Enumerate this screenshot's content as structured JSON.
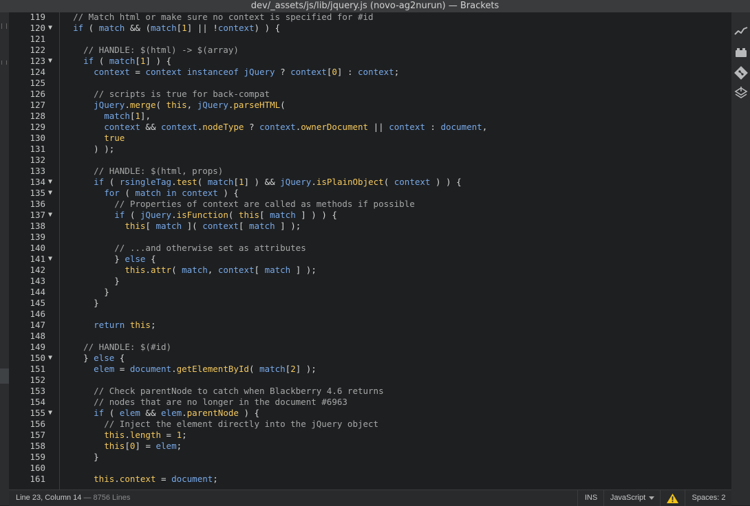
{
  "window": {
    "title": "dev/_assets/js/lib/jquery.js (novo-ag2nurun) — Brackets"
  },
  "editor": {
    "lines": [
      {
        "num": "119",
        "fold": "",
        "indent": "  ",
        "tokens": [
          {
            "t": "// Match html or make sure no context is specified for #id",
            "c": "comment"
          }
        ]
      },
      {
        "num": "120",
        "fold": "▼",
        "indent": "  ",
        "tokens": [
          {
            "t": "if",
            "c": "kw"
          },
          {
            "t": " ( ",
            "c": "plain"
          },
          {
            "t": "match",
            "c": "var"
          },
          {
            "t": " && (",
            "c": "plain"
          },
          {
            "t": "match",
            "c": "var"
          },
          {
            "t": "[",
            "c": "plain"
          },
          {
            "t": "1",
            "c": "num"
          },
          {
            "t": "] || !",
            "c": "plain"
          },
          {
            "t": "context",
            "c": "var"
          },
          {
            "t": ") ) {",
            "c": "plain"
          }
        ]
      },
      {
        "num": "121",
        "fold": "",
        "indent": "",
        "tokens": []
      },
      {
        "num": "122",
        "fold": "",
        "indent": "    ",
        "tokens": [
          {
            "t": "// HANDLE: $(html) -> $(array)",
            "c": "comment"
          }
        ]
      },
      {
        "num": "123",
        "fold": "▼",
        "indent": "    ",
        "tokens": [
          {
            "t": "if",
            "c": "kw"
          },
          {
            "t": " ( ",
            "c": "plain"
          },
          {
            "t": "match",
            "c": "var"
          },
          {
            "t": "[",
            "c": "plain"
          },
          {
            "t": "1",
            "c": "num"
          },
          {
            "t": "] ) {",
            "c": "plain"
          }
        ]
      },
      {
        "num": "124",
        "fold": "",
        "indent": "      ",
        "tokens": [
          {
            "t": "context",
            "c": "var"
          },
          {
            "t": " = ",
            "c": "plain"
          },
          {
            "t": "context",
            "c": "var"
          },
          {
            "t": " instanceof ",
            "c": "kw"
          },
          {
            "t": "jQuery",
            "c": "var"
          },
          {
            "t": " ? ",
            "c": "plain"
          },
          {
            "t": "context",
            "c": "var"
          },
          {
            "t": "[",
            "c": "plain"
          },
          {
            "t": "0",
            "c": "num"
          },
          {
            "t": "] : ",
            "c": "plain"
          },
          {
            "t": "context",
            "c": "var"
          },
          {
            "t": ";",
            "c": "plain"
          }
        ]
      },
      {
        "num": "125",
        "fold": "",
        "indent": "",
        "tokens": []
      },
      {
        "num": "126",
        "fold": "",
        "indent": "      ",
        "tokens": [
          {
            "t": "// scripts is true for back-compat",
            "c": "comment"
          }
        ]
      },
      {
        "num": "127",
        "fold": "",
        "indent": "      ",
        "tokens": [
          {
            "t": "jQuery",
            "c": "var"
          },
          {
            "t": ".",
            "c": "plain"
          },
          {
            "t": "merge",
            "c": "fn"
          },
          {
            "t": "( ",
            "c": "plain"
          },
          {
            "t": "this",
            "c": "lit"
          },
          {
            "t": ", ",
            "c": "plain"
          },
          {
            "t": "jQuery",
            "c": "var"
          },
          {
            "t": ".",
            "c": "plain"
          },
          {
            "t": "parseHTML",
            "c": "fn"
          },
          {
            "t": "(",
            "c": "plain"
          }
        ]
      },
      {
        "num": "128",
        "fold": "",
        "indent": "        ",
        "tokens": [
          {
            "t": "match",
            "c": "var"
          },
          {
            "t": "[",
            "c": "plain"
          },
          {
            "t": "1",
            "c": "num"
          },
          {
            "t": "],",
            "c": "plain"
          }
        ]
      },
      {
        "num": "129",
        "fold": "",
        "indent": "        ",
        "tokens": [
          {
            "t": "context",
            "c": "var"
          },
          {
            "t": " && ",
            "c": "plain"
          },
          {
            "t": "context",
            "c": "var"
          },
          {
            "t": ".",
            "c": "plain"
          },
          {
            "t": "nodeType",
            "c": "fn"
          },
          {
            "t": " ? ",
            "c": "plain"
          },
          {
            "t": "context",
            "c": "var"
          },
          {
            "t": ".",
            "c": "plain"
          },
          {
            "t": "ownerDocument",
            "c": "fn"
          },
          {
            "t": " || ",
            "c": "plain"
          },
          {
            "t": "context",
            "c": "var"
          },
          {
            "t": " : ",
            "c": "plain"
          },
          {
            "t": "document",
            "c": "var"
          },
          {
            "t": ",",
            "c": "plain"
          }
        ]
      },
      {
        "num": "130",
        "fold": "",
        "indent": "        ",
        "tokens": [
          {
            "t": "true",
            "c": "lit"
          }
        ]
      },
      {
        "num": "131",
        "fold": "",
        "indent": "      ",
        "tokens": [
          {
            "t": ") );",
            "c": "plain"
          }
        ]
      },
      {
        "num": "132",
        "fold": "",
        "indent": "",
        "tokens": []
      },
      {
        "num": "133",
        "fold": "",
        "indent": "      ",
        "tokens": [
          {
            "t": "// HANDLE: $(html, props)",
            "c": "comment"
          }
        ]
      },
      {
        "num": "134",
        "fold": "▼",
        "indent": "      ",
        "tokens": [
          {
            "t": "if",
            "c": "kw"
          },
          {
            "t": " ( ",
            "c": "plain"
          },
          {
            "t": "rsingleTag",
            "c": "var"
          },
          {
            "t": ".",
            "c": "plain"
          },
          {
            "t": "test",
            "c": "fn"
          },
          {
            "t": "( ",
            "c": "plain"
          },
          {
            "t": "match",
            "c": "var"
          },
          {
            "t": "[",
            "c": "plain"
          },
          {
            "t": "1",
            "c": "num"
          },
          {
            "t": "] ) && ",
            "c": "plain"
          },
          {
            "t": "jQuery",
            "c": "var"
          },
          {
            "t": ".",
            "c": "plain"
          },
          {
            "t": "isPlainObject",
            "c": "fn"
          },
          {
            "t": "( ",
            "c": "plain"
          },
          {
            "t": "context",
            "c": "var"
          },
          {
            "t": " ) ) {",
            "c": "plain"
          }
        ]
      },
      {
        "num": "135",
        "fold": "▼",
        "indent": "        ",
        "tokens": [
          {
            "t": "for",
            "c": "kw"
          },
          {
            "t": " ( ",
            "c": "plain"
          },
          {
            "t": "match",
            "c": "var"
          },
          {
            "t": " in ",
            "c": "kw"
          },
          {
            "t": "context",
            "c": "var"
          },
          {
            "t": " ) {",
            "c": "plain"
          }
        ]
      },
      {
        "num": "136",
        "fold": "",
        "indent": "          ",
        "tokens": [
          {
            "t": "// Properties of context are called as methods if possible",
            "c": "comment"
          }
        ]
      },
      {
        "num": "137",
        "fold": "▼",
        "indent": "          ",
        "tokens": [
          {
            "t": "if",
            "c": "kw"
          },
          {
            "t": " ( ",
            "c": "plain"
          },
          {
            "t": "jQuery",
            "c": "var"
          },
          {
            "t": ".",
            "c": "plain"
          },
          {
            "t": "isFunction",
            "c": "fn"
          },
          {
            "t": "( ",
            "c": "plain"
          },
          {
            "t": "this",
            "c": "lit"
          },
          {
            "t": "[ ",
            "c": "plain"
          },
          {
            "t": "match",
            "c": "var"
          },
          {
            "t": " ] ) ) {",
            "c": "plain"
          }
        ]
      },
      {
        "num": "138",
        "fold": "",
        "indent": "            ",
        "tokens": [
          {
            "t": "this",
            "c": "lit"
          },
          {
            "t": "[ ",
            "c": "plain"
          },
          {
            "t": "match",
            "c": "var"
          },
          {
            "t": " ]( ",
            "c": "plain"
          },
          {
            "t": "context",
            "c": "var"
          },
          {
            "t": "[ ",
            "c": "plain"
          },
          {
            "t": "match",
            "c": "var"
          },
          {
            "t": " ] );",
            "c": "plain"
          }
        ]
      },
      {
        "num": "139",
        "fold": "",
        "indent": "",
        "tokens": []
      },
      {
        "num": "140",
        "fold": "",
        "indent": "          ",
        "tokens": [
          {
            "t": "// ...and otherwise set as attributes",
            "c": "comment"
          }
        ]
      },
      {
        "num": "141",
        "fold": "▼",
        "indent": "          ",
        "tokens": [
          {
            "t": "} ",
            "c": "plain"
          },
          {
            "t": "else",
            "c": "kw"
          },
          {
            "t": " {",
            "c": "plain"
          }
        ]
      },
      {
        "num": "142",
        "fold": "",
        "indent": "            ",
        "tokens": [
          {
            "t": "this",
            "c": "lit"
          },
          {
            "t": ".",
            "c": "plain"
          },
          {
            "t": "attr",
            "c": "fn"
          },
          {
            "t": "( ",
            "c": "plain"
          },
          {
            "t": "match",
            "c": "var"
          },
          {
            "t": ", ",
            "c": "plain"
          },
          {
            "t": "context",
            "c": "var"
          },
          {
            "t": "[ ",
            "c": "plain"
          },
          {
            "t": "match",
            "c": "var"
          },
          {
            "t": " ] );",
            "c": "plain"
          }
        ]
      },
      {
        "num": "143",
        "fold": "",
        "indent": "          ",
        "tokens": [
          {
            "t": "}",
            "c": "plain"
          }
        ]
      },
      {
        "num": "144",
        "fold": "",
        "indent": "        ",
        "tokens": [
          {
            "t": "}",
            "c": "plain"
          }
        ]
      },
      {
        "num": "145",
        "fold": "",
        "indent": "      ",
        "tokens": [
          {
            "t": "}",
            "c": "plain"
          }
        ]
      },
      {
        "num": "146",
        "fold": "",
        "indent": "",
        "tokens": []
      },
      {
        "num": "147",
        "fold": "",
        "indent": "      ",
        "tokens": [
          {
            "t": "return ",
            "c": "kw"
          },
          {
            "t": "this",
            "c": "lit"
          },
          {
            "t": ";",
            "c": "plain"
          }
        ]
      },
      {
        "num": "148",
        "fold": "",
        "indent": "",
        "tokens": []
      },
      {
        "num": "149",
        "fold": "",
        "indent": "    ",
        "tokens": [
          {
            "t": "// HANDLE: $(#id)",
            "c": "comment"
          }
        ]
      },
      {
        "num": "150",
        "fold": "▼",
        "indent": "    ",
        "tokens": [
          {
            "t": "} ",
            "c": "plain"
          },
          {
            "t": "else",
            "c": "kw"
          },
          {
            "t": " {",
            "c": "plain"
          }
        ]
      },
      {
        "num": "151",
        "fold": "",
        "indent": "      ",
        "tokens": [
          {
            "t": "elem",
            "c": "var"
          },
          {
            "t": " = ",
            "c": "plain"
          },
          {
            "t": "document",
            "c": "var"
          },
          {
            "t": ".",
            "c": "plain"
          },
          {
            "t": "getElementById",
            "c": "fn"
          },
          {
            "t": "( ",
            "c": "plain"
          },
          {
            "t": "match",
            "c": "var"
          },
          {
            "t": "[",
            "c": "plain"
          },
          {
            "t": "2",
            "c": "num"
          },
          {
            "t": "] );",
            "c": "plain"
          }
        ]
      },
      {
        "num": "152",
        "fold": "",
        "indent": "",
        "tokens": []
      },
      {
        "num": "153",
        "fold": "",
        "indent": "      ",
        "tokens": [
          {
            "t": "// Check parentNode to catch when Blackberry 4.6 returns",
            "c": "comment"
          }
        ]
      },
      {
        "num": "154",
        "fold": "",
        "indent": "      ",
        "tokens": [
          {
            "t": "// nodes that are no longer in the document #6963",
            "c": "comment"
          }
        ]
      },
      {
        "num": "155",
        "fold": "▼",
        "indent": "      ",
        "tokens": [
          {
            "t": "if",
            "c": "kw"
          },
          {
            "t": " ( ",
            "c": "plain"
          },
          {
            "t": "elem",
            "c": "var"
          },
          {
            "t": " && ",
            "c": "plain"
          },
          {
            "t": "elem",
            "c": "var"
          },
          {
            "t": ".",
            "c": "plain"
          },
          {
            "t": "parentNode",
            "c": "fn"
          },
          {
            "t": " ) {",
            "c": "plain"
          }
        ]
      },
      {
        "num": "156",
        "fold": "",
        "indent": "        ",
        "tokens": [
          {
            "t": "// Inject the element directly into the jQuery object",
            "c": "comment"
          }
        ]
      },
      {
        "num": "157",
        "fold": "",
        "indent": "        ",
        "tokens": [
          {
            "t": "this",
            "c": "lit"
          },
          {
            "t": ".",
            "c": "plain"
          },
          {
            "t": "length",
            "c": "fn"
          },
          {
            "t": " = ",
            "c": "plain"
          },
          {
            "t": "1",
            "c": "num"
          },
          {
            "t": ";",
            "c": "plain"
          }
        ]
      },
      {
        "num": "158",
        "fold": "",
        "indent": "        ",
        "tokens": [
          {
            "t": "this",
            "c": "lit"
          },
          {
            "t": "[",
            "c": "plain"
          },
          {
            "t": "0",
            "c": "num"
          },
          {
            "t": "] = ",
            "c": "plain"
          },
          {
            "t": "elem",
            "c": "var"
          },
          {
            "t": ";",
            "c": "plain"
          }
        ]
      },
      {
        "num": "159",
        "fold": "",
        "indent": "      ",
        "tokens": [
          {
            "t": "}",
            "c": "plain"
          }
        ]
      },
      {
        "num": "160",
        "fold": "",
        "indent": "",
        "tokens": []
      },
      {
        "num": "161",
        "fold": "",
        "indent": "      ",
        "tokens": [
          {
            "t": "this",
            "c": "lit"
          },
          {
            "t": ".",
            "c": "plain"
          },
          {
            "t": "context",
            "c": "fn"
          },
          {
            "t": " = ",
            "c": "plain"
          },
          {
            "t": "document",
            "c": "var"
          },
          {
            "t": ";",
            "c": "plain"
          }
        ]
      }
    ]
  },
  "statusbar": {
    "cursor": "Line 23, Column 14",
    "line_count": " — 8756 Lines",
    "mode": "INS",
    "language": "JavaScript",
    "spaces": "Spaces: 2"
  },
  "toolbar_icons": [
    "live-preview-icon",
    "extension-manager-icon",
    "git-icon",
    "layers-icon"
  ],
  "colors": {
    "background": "#1d1f21",
    "keyword": "#79a9e7",
    "function": "#f5c95e",
    "comment": "#a7a9a8",
    "warning": "#f5c518"
  }
}
